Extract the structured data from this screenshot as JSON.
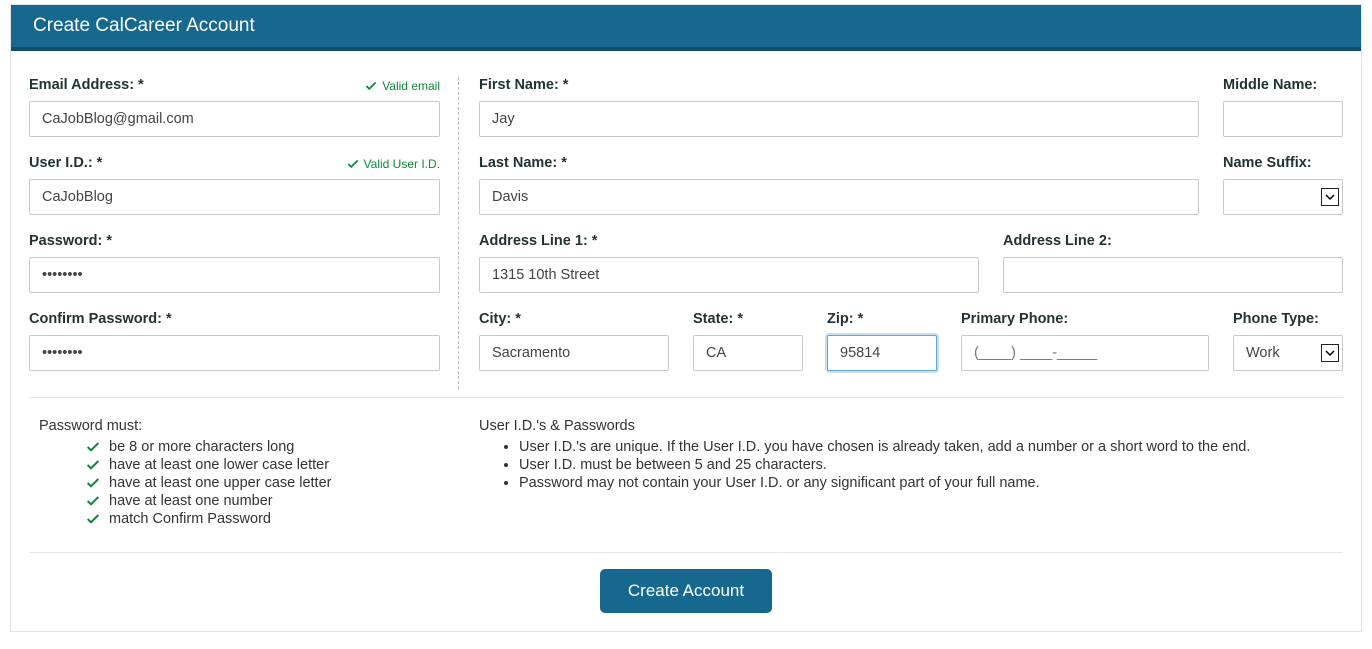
{
  "header": {
    "title": "Create CalCareer Account"
  },
  "left": {
    "email": {
      "label": "Email Address: *",
      "value": "CaJobBlog@gmail.com",
      "valid_msg": "Valid email"
    },
    "userid": {
      "label": "User I.D.: *",
      "value": "CaJobBlog",
      "valid_msg": "Valid User I.D."
    },
    "password": {
      "label": "Password: *",
      "value": "••••••••"
    },
    "confirm": {
      "label": "Confirm Password: *",
      "value": "••••••••"
    }
  },
  "right": {
    "first_name": {
      "label": "First Name: *",
      "value": "Jay"
    },
    "middle_name": {
      "label": "Middle Name:",
      "value": ""
    },
    "last_name": {
      "label": "Last Name: *",
      "value": "Davis"
    },
    "suffix": {
      "label": "Name Suffix:",
      "value": ""
    },
    "addr1": {
      "label": "Address Line 1: *",
      "value": "1315 10th Street"
    },
    "addr2": {
      "label": "Address Line 2:",
      "value": ""
    },
    "city": {
      "label": "City: *",
      "value": "Sacramento"
    },
    "state": {
      "label": "State: *",
      "value": "CA"
    },
    "zip": {
      "label": "Zip: *",
      "value": "95814"
    },
    "phone": {
      "label": "Primary Phone:",
      "placeholder": "(____) ____-_____"
    },
    "phone_type": {
      "label": "Phone Type:",
      "value": "Work"
    }
  },
  "password_rules": {
    "heading": "Password must:",
    "items": [
      "be 8 or more characters long",
      "have at least one lower case letter",
      "have at least one upper case letter",
      "have at least one number",
      "match Confirm Password"
    ]
  },
  "userid_rules": {
    "heading": "User I.D.'s & Passwords",
    "items": [
      "User I.D.'s are unique. If the User I.D. you have chosen is already taken, add a number or a short word to the end.",
      "User I.D. must be between 5 and 25 characters.",
      "Password may not contain your User I.D. or any significant part of your full name."
    ]
  },
  "actions": {
    "create": "Create Account"
  }
}
